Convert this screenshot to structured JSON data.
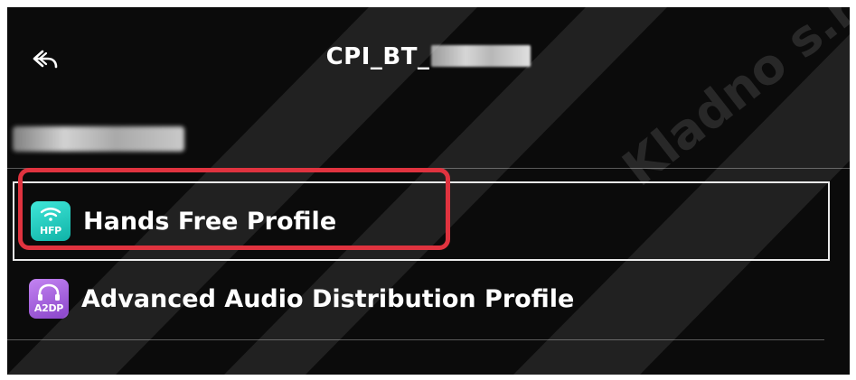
{
  "header": {
    "back_icon": "back-arrow-icon",
    "title": "CPI_BT_"
  },
  "profiles": [
    {
      "label": "Hands Free Profile",
      "icon": "hfp-icon",
      "icon_text": "HFP",
      "icon_color": "#1fd1c3",
      "selected": true
    },
    {
      "label": "Advanced Audio Distribution Profile",
      "icon": "a2dp-icon",
      "icon_text": "A2DP",
      "icon_color": "#9b5bd9",
      "selected": false
    }
  ],
  "watermark": {
    "text": "Kladno s.r.o."
  },
  "colors": {
    "screen_bg": "#0b0b0b",
    "annotation": "#e0333f",
    "selection_border": "#e9e9e9"
  }
}
